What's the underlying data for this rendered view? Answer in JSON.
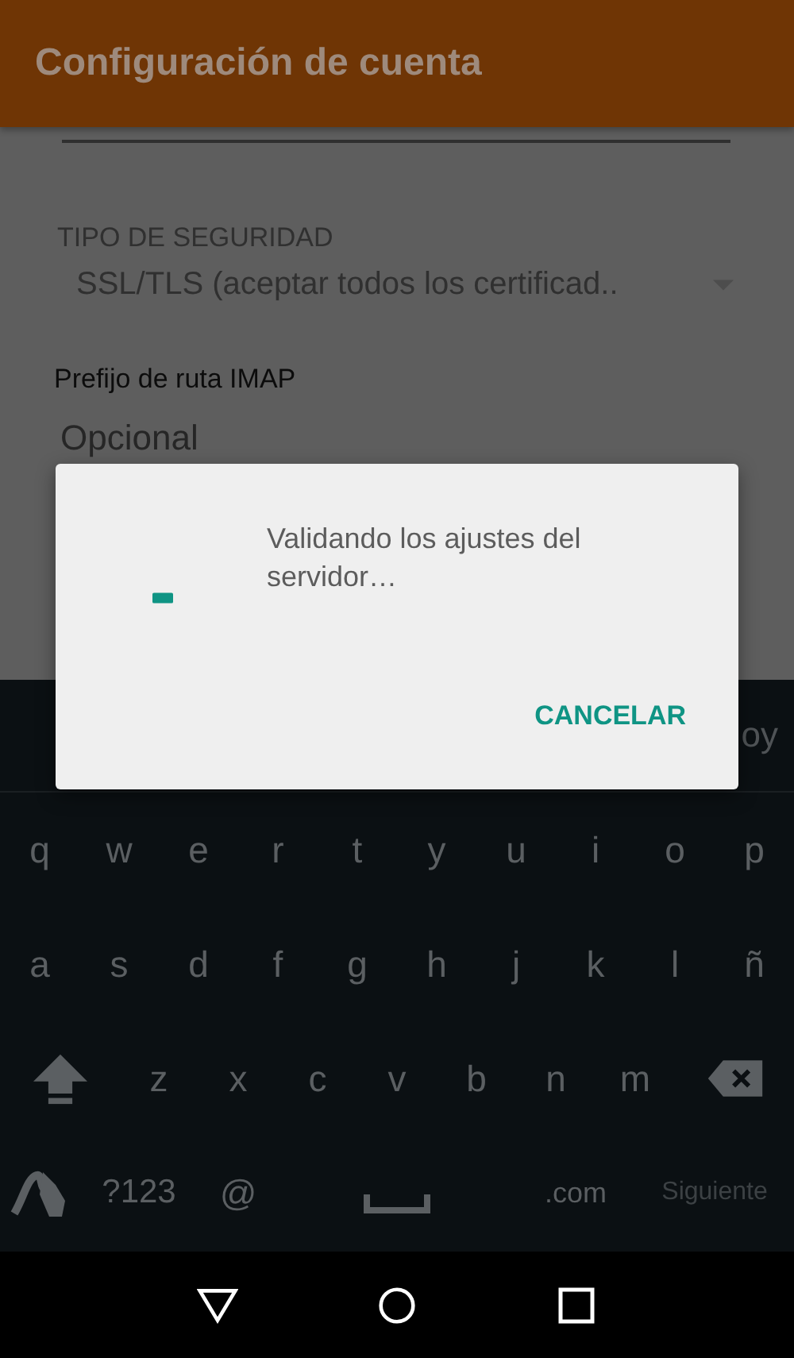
{
  "app_bar": {
    "title": "Configuración de cuenta"
  },
  "form": {
    "security_type": {
      "label": "TIPO DE SEGURIDAD",
      "value": "SSL/TLS (aceptar todos los certificad..",
      "disabled": true
    },
    "imap_prefix": {
      "label": "Prefijo de ruta IMAP",
      "placeholder": "Opcional"
    }
  },
  "dialog": {
    "message": "Validando los ajustes del servidor…",
    "buttons": [
      "CANCELAR"
    ]
  },
  "keyboard": {
    "suggestion": "oy",
    "rows": [
      [
        {
          "kind": "letter",
          "label": "q"
        },
        {
          "kind": "letter",
          "label": "w"
        },
        {
          "kind": "letter",
          "label": "e"
        },
        {
          "kind": "letter",
          "label": "r"
        },
        {
          "kind": "letter",
          "label": "t"
        },
        {
          "kind": "letter",
          "label": "y"
        },
        {
          "kind": "letter",
          "label": "u"
        },
        {
          "kind": "letter",
          "label": "i"
        },
        {
          "kind": "letter",
          "label": "o"
        },
        {
          "kind": "letter",
          "label": "p"
        }
      ],
      [
        {
          "kind": "letter",
          "label": "a"
        },
        {
          "kind": "letter",
          "label": "s"
        },
        {
          "kind": "letter",
          "label": "d"
        },
        {
          "kind": "letter",
          "label": "f"
        },
        {
          "kind": "letter",
          "label": "g"
        },
        {
          "kind": "letter",
          "label": "h"
        },
        {
          "kind": "letter",
          "label": "j"
        },
        {
          "kind": "letter",
          "label": "k"
        },
        {
          "kind": "letter",
          "label": "l"
        },
        {
          "kind": "letter",
          "label": "ñ"
        }
      ],
      [
        {
          "kind": "shift"
        },
        {
          "kind": "letter",
          "label": "z"
        },
        {
          "kind": "letter",
          "label": "x"
        },
        {
          "kind": "letter",
          "label": "c"
        },
        {
          "kind": "letter",
          "label": "v"
        },
        {
          "kind": "letter",
          "label": "b"
        },
        {
          "kind": "letter",
          "label": "n"
        },
        {
          "kind": "letter",
          "label": "m"
        },
        {
          "kind": "backspace"
        }
      ]
    ],
    "bottom_row": [
      {
        "kind": "gesture"
      },
      {
        "kind": "symbols",
        "label": "?123"
      },
      {
        "kind": "letter",
        "label": "@"
      },
      {
        "kind": "space"
      },
      {
        "kind": "text",
        "label": ".com"
      },
      {
        "kind": "action",
        "label": "Siguiente"
      }
    ]
  }
}
